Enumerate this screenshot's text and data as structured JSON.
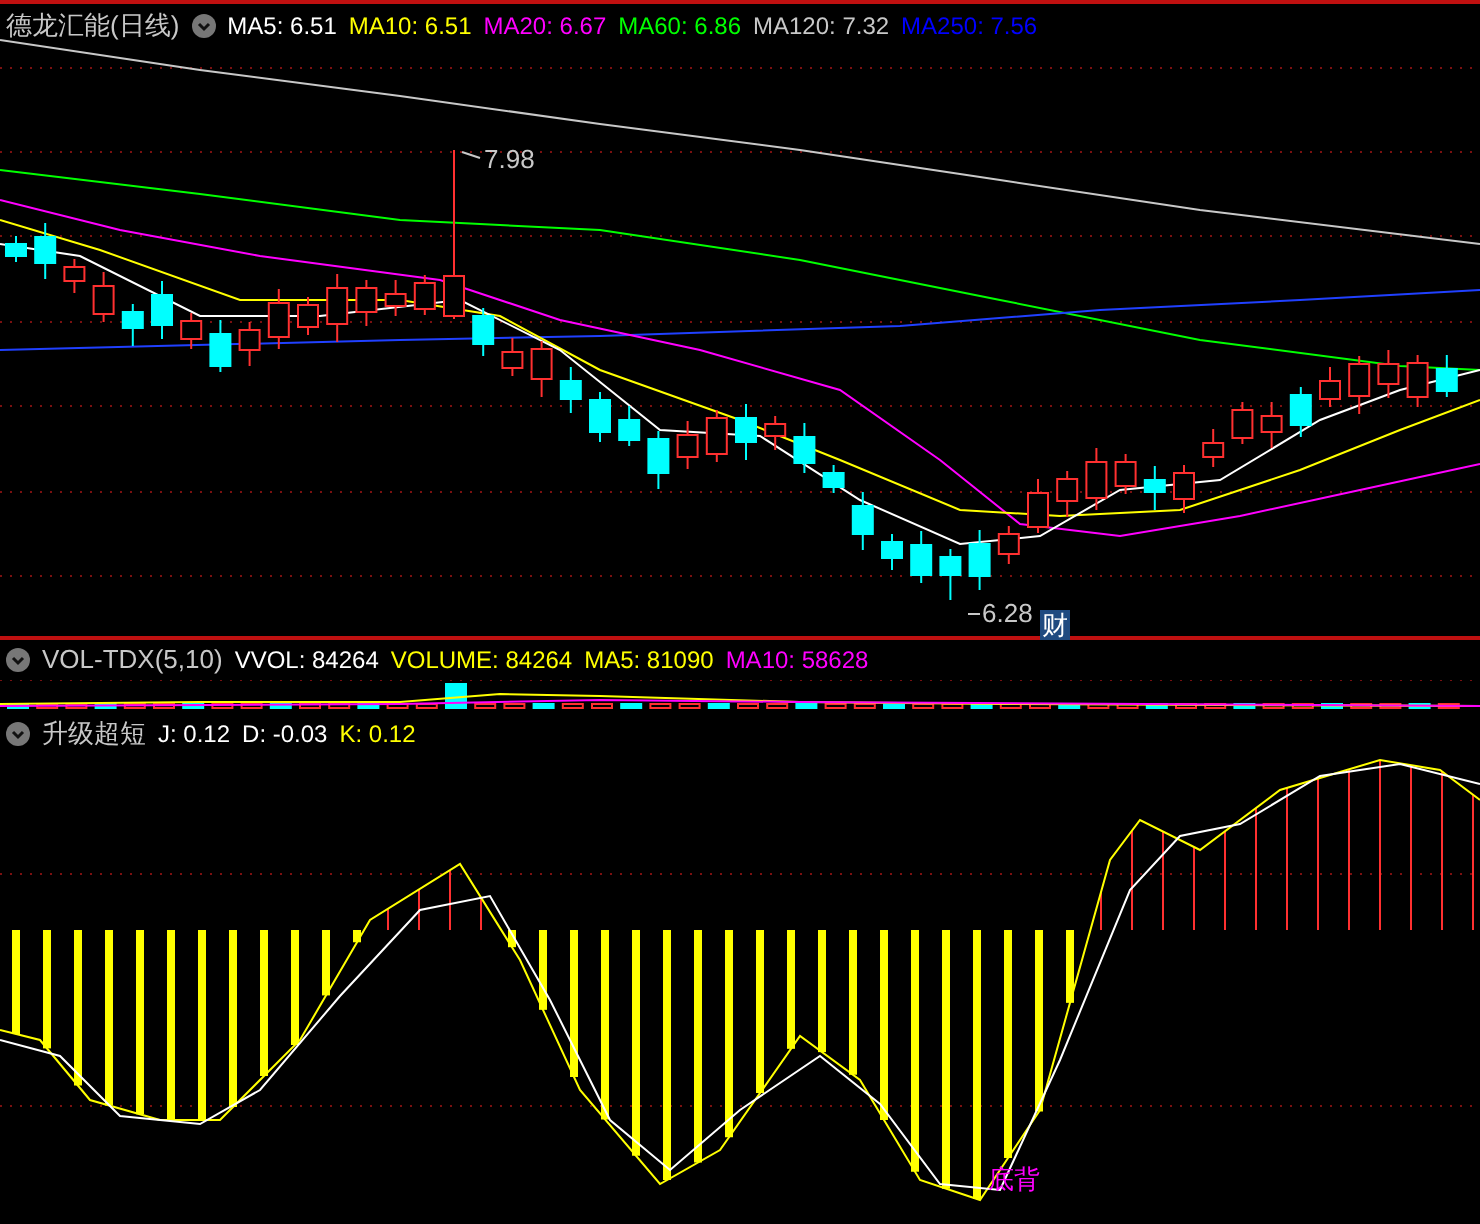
{
  "main": {
    "title": "德龙汇能(日线)",
    "legend": [
      {
        "label": "MA5: 6.51",
        "color": "#ffffff"
      },
      {
        "label": "MA10: 6.51",
        "color": "#ffff00"
      },
      {
        "label": "MA20: 6.67",
        "color": "#ff00ff"
      },
      {
        "label": "MA60: 6.86",
        "color": "#00ff00"
      },
      {
        "label": "MA120: 7.32",
        "color": "#c8c8c8"
      },
      {
        "label": "MA250: 7.56",
        "color": "#0000ff"
      }
    ],
    "high_label": "7.98",
    "low_label": "6.28",
    "badge": "财"
  },
  "volume": {
    "title": "VOL-TDX(5,10)",
    "legend": [
      {
        "label": "VVOL: 84264",
        "color": "#ffffff"
      },
      {
        "label": "VOLUME: 84264",
        "color": "#ffff00"
      },
      {
        "label": "MA5: 81090",
        "color": "#ffff00"
      },
      {
        "label": "MA10: 58628",
        "color": "#ff00ff"
      }
    ]
  },
  "indicator": {
    "title": "升级超短",
    "legend": [
      {
        "label": "J: 0.12",
        "color": "#ffffff"
      },
      {
        "label": "D: -0.03",
        "color": "#ffffff"
      },
      {
        "label": "K: 0.12",
        "color": "#ffff00"
      }
    ],
    "signal": "底背"
  }
}
